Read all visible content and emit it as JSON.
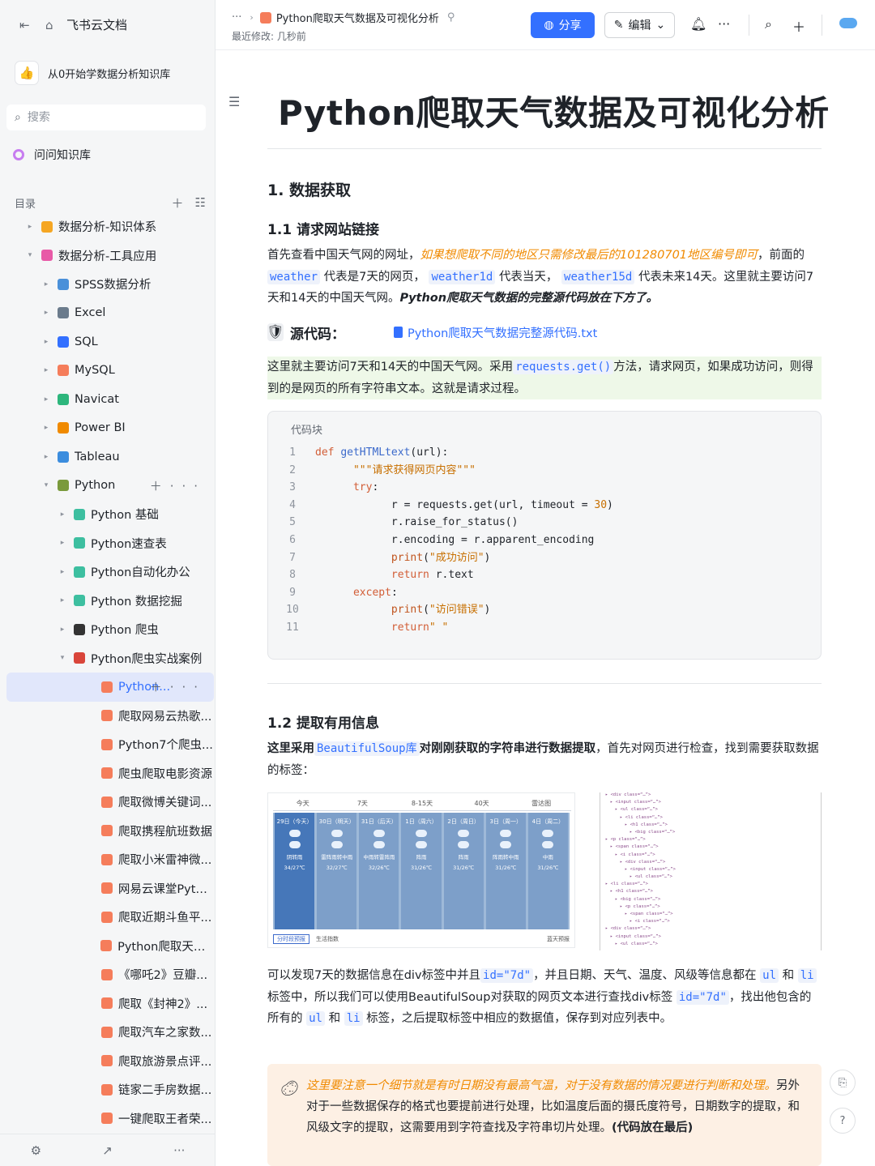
{
  "sidebar": {
    "home_title": "飞书云文档",
    "kb_name": "从0开始学数据分析知识库",
    "search_placeholder": "搜索",
    "ask_label": "问问知识库",
    "dir_label": "目录",
    "items": [
      {
        "label": "数据分析-知识体系",
        "level": 0,
        "toggle": "▸",
        "icon": "folder-icon",
        "color": "#f5a623"
      },
      {
        "label": "数据分析-工具应用",
        "level": 0,
        "toggle": "▾",
        "icon": "folder-icon",
        "color": "#e85aa7"
      },
      {
        "label": "SPSS数据分析",
        "level": 1,
        "toggle": "▸",
        "icon": "spss-icon",
        "color": "#4a90d9"
      },
      {
        "label": "Excel",
        "level": 1,
        "toggle": "▸",
        "icon": "excel-icon",
        "color": "#6b7b8c"
      },
      {
        "label": "SQL",
        "level": 1,
        "toggle": "▸",
        "icon": "sql-icon",
        "color": "#3370ff"
      },
      {
        "label": "MySQL",
        "level": 1,
        "toggle": "▸",
        "icon": "mysql-icon",
        "color": "#f57d5b"
      },
      {
        "label": "Navicat",
        "level": 1,
        "toggle": "▸",
        "icon": "navicat-icon",
        "color": "#2db67c"
      },
      {
        "label": "Power BI",
        "level": 1,
        "toggle": "▸",
        "icon": "flame-icon",
        "color": "#f08a00"
      },
      {
        "label": "Tableau",
        "level": 1,
        "toggle": "▸",
        "icon": "drop-icon",
        "color": "#3c8dde"
      },
      {
        "label": "Python",
        "level": 1,
        "toggle": "▾",
        "icon": "python-icon",
        "color": "#7a9a3c"
      },
      {
        "label": "Python 基础",
        "level": 2,
        "toggle": "▸",
        "icon": "page-icon",
        "color": "#3dbfa0"
      },
      {
        "label": "Python速查表",
        "level": 2,
        "toggle": "▸",
        "icon": "page-icon",
        "color": "#3dbfa0"
      },
      {
        "label": "Python自动化办公",
        "level": 2,
        "toggle": "▸",
        "icon": "page-icon",
        "color": "#3dbfa0"
      },
      {
        "label": "Python 数据挖掘",
        "level": 2,
        "toggle": "▸",
        "icon": "page-icon",
        "color": "#3dbfa0"
      },
      {
        "label": "Python 爬虫",
        "level": 2,
        "toggle": "▸",
        "icon": "spider-icon",
        "color": "#333333"
      },
      {
        "label": "Python爬虫实战案例",
        "level": 2,
        "toggle": "▾",
        "icon": "target-icon",
        "color": "#d9453a"
      },
      {
        "label": "Python...",
        "level": 3,
        "toggle": "",
        "icon": "doc-icon",
        "color": "#f57d5b"
      },
      {
        "label": "爬取网易云热歌...",
        "level": 3,
        "toggle": "",
        "icon": "doc-icon",
        "color": "#f57d5b"
      },
      {
        "label": "Python7个爬虫...",
        "level": 3,
        "toggle": "",
        "icon": "doc-icon",
        "color": "#f57d5b"
      },
      {
        "label": "爬虫爬取电影资源",
        "level": 3,
        "toggle": "",
        "icon": "doc-icon",
        "color": "#f57d5b"
      },
      {
        "label": "爬取微博关键词...",
        "level": 3,
        "toggle": "",
        "icon": "doc-icon",
        "color": "#f57d5b"
      },
      {
        "label": "爬取携程航班数据",
        "level": 3,
        "toggle": "",
        "icon": "doc-icon",
        "color": "#f57d5b"
      },
      {
        "label": "爬取小米雷神微...",
        "level": 3,
        "toggle": "",
        "icon": "doc-icon",
        "color": "#f57d5b"
      },
      {
        "label": "网易云课堂Pyth...",
        "level": 3,
        "toggle": "",
        "icon": "doc-icon",
        "color": "#f57d5b"
      },
      {
        "label": "爬取近期斗鱼平...",
        "level": 3,
        "toggle": "",
        "icon": "doc-icon",
        "color": "#f57d5b"
      },
      {
        "label": "Python爬取天气...",
        "level": 3,
        "toggle": "",
        "icon": "doc-icon",
        "color": "#f57d5b"
      },
      {
        "label": "《哪吒2》豆瓣...",
        "level": 3,
        "toggle": "",
        "icon": "doc-icon",
        "color": "#f57d5b"
      },
      {
        "label": "爬取《封神2》...",
        "level": 3,
        "toggle": "",
        "icon": "doc-icon",
        "color": "#f57d5b"
      },
      {
        "label": "爬取汽车之家数...",
        "level": 3,
        "toggle": "",
        "icon": "doc-icon",
        "color": "#f57d5b"
      },
      {
        "label": "爬取旅游景点评...",
        "level": 3,
        "toggle": "",
        "icon": "doc-icon",
        "color": "#f57d5b"
      },
      {
        "label": "链家二手房数据...",
        "level": 3,
        "toggle": "",
        "icon": "doc-icon",
        "color": "#f57d5b"
      },
      {
        "label": "一键爬取王者荣...",
        "level": 3,
        "toggle": "",
        "icon": "doc-icon",
        "color": "#f57d5b"
      }
    ]
  },
  "header": {
    "crumb_dots": "···",
    "crumb_doc": "Python爬取天气数据及可视化分析",
    "modified": "最近修改: 几秒前",
    "share": "分享",
    "edit": "编辑"
  },
  "doc": {
    "title": "Python爬取天气数据及可视化分析",
    "h1": "1. 数据获取",
    "h11": "1.1  请求网站链接",
    "p1_a": "首先查看中国天气网的网址，",
    "p1_orange": "如果想爬取不同的地区只需修改最后的101280701地区编号即可",
    "p1_b": "，前面的",
    "c_weather": "weather",
    "p1_c": "代表是7天的网页，",
    "c_weather1d": "weather1d",
    "p1_d": "代表当天，",
    "c_weather15d": "weather15d",
    "p1_e": "代表未来14天。这里就主要访问7天和14天的中国天气网。",
    "p1_boldi": "Python爬取天气数据的完整源代码放在下方了。",
    "src_label": "源代码：",
    "src_link": "Python爬取天气数据完整源代码.txt",
    "green_a": "这里就主要访问7天和14天的中国天气网。采用",
    "c_requests": "requests.get()",
    "green_b": "方法，请求网页，如果成功访问，则得到的是网页的所有字符串文本。这就是请求过程。",
    "code_caption": "代码块",
    "code_lines": [
      {
        "n": "1",
        "indent": "",
        "parts": [
          [
            "kw",
            "def "
          ],
          [
            "fn",
            "getHTMLtext"
          ],
          [
            "",
            "(url):"
          ]
        ]
      },
      {
        "n": "2",
        "indent": "      ",
        "parts": [
          [
            "st",
            "\"\"\"请求获得网页内容\"\"\""
          ]
        ]
      },
      {
        "n": "3",
        "indent": "      ",
        "parts": [
          [
            "kw",
            "try"
          ],
          [
            "",
            ":"
          ]
        ]
      },
      {
        "n": "4",
        "indent": "            ",
        "parts": [
          [
            "",
            "r = requests.get(url, timeout = "
          ],
          [
            "st",
            "30"
          ],
          [
            "",
            ")"
          ]
        ]
      },
      {
        "n": "5",
        "indent": "            ",
        "parts": [
          [
            "",
            "r.raise_for_status()"
          ]
        ]
      },
      {
        "n": "6",
        "indent": "            ",
        "parts": [
          [
            "",
            "r.encoding = r.apparent_encoding"
          ]
        ]
      },
      {
        "n": "7",
        "indent": "            ",
        "parts": [
          [
            "pr",
            "print"
          ],
          [
            "",
            "("
          ],
          [
            "st",
            "\"成功访问\""
          ],
          [
            "",
            ")"
          ]
        ]
      },
      {
        "n": "8",
        "indent": "            ",
        "parts": [
          [
            "kw",
            "return "
          ],
          [
            "",
            "r.text"
          ]
        ]
      },
      {
        "n": "9",
        "indent": "      ",
        "parts": [
          [
            "kw",
            "except"
          ],
          [
            "",
            ":"
          ]
        ]
      },
      {
        "n": "10",
        "indent": "            ",
        "parts": [
          [
            "pr",
            "print"
          ],
          [
            "",
            "("
          ],
          [
            "st",
            "\"访问错误\""
          ],
          [
            "",
            ")"
          ]
        ]
      },
      {
        "n": "11",
        "indent": "            ",
        "parts": [
          [
            "kw",
            "return"
          ],
          [
            "st",
            "\" \""
          ]
        ]
      }
    ],
    "h12": "1.2 提取有用信息",
    "p2_bold_a": "这里采用",
    "c_bs": "BeautifulSoup库",
    "p2_bold_b": "对刚刚获取的字符串进行数据提取",
    "p2_c": "，首先对网页进行检查，找到需要获取数据的标签：",
    "weather_tabs": [
      "今天",
      "7天",
      "8-15天",
      "40天",
      "雷达图"
    ],
    "weather_days": [
      "29日（今天）",
      "30日（明天）",
      "31日（后天）",
      "1日（周六）",
      "2日（周日）",
      "3日（周一）",
      "4日（周二）"
    ],
    "weather_desc": [
      "阴转雨",
      "雷阵雨转中雨",
      "中雨转雷阵雨",
      "阵雨",
      "阵雨",
      "阵雨转中雨",
      "中雨"
    ],
    "weather_temp": [
      "34/27℃",
      "32/27℃",
      "32/26℃",
      "31/26℃",
      "31/26℃",
      "31/26℃",
      "31/26℃"
    ],
    "weather_foot_a": "分时段预报",
    "weather_foot_b": "生活指数",
    "weather_foot_c": "蓝天预报",
    "p3_a": "可以发现7天的数据信息在div标签中并且",
    "c_id7d": "id=\"7d\"",
    "p3_b": "，并且日期、天气、温度、风级等信息都在",
    "c_ul": "ul",
    "p3_c": "和",
    "c_li": "li",
    "p3_d": "标签中，所以我们可以使用BeautifulSoup对获取的网页文本进行查找div标签",
    "p3_e": "，找出他包含的所有的",
    "p3_f": "标签，之后提取标签中相应的数据值，保存到对应列表中。",
    "callout_italic": "这里要注意一个细节就是有时日期没有最高气温，对于没有数据的情况要进行判断和处理。",
    "callout_rest": "另外对于一些数据保存的格式也要提前进行处理，比如温度后面的摄氏度符号，日期数字的提取，和风级文字的提取，这需要用到字符查找及字符串切片处理。",
    "callout_bold": "(代码放在最后)"
  }
}
